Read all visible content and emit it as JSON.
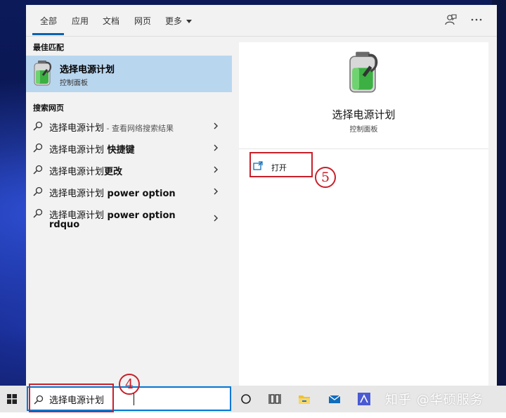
{
  "tabs": [
    {
      "label": "全部",
      "active": true
    },
    {
      "label": "应用"
    },
    {
      "label": "文档"
    },
    {
      "label": "网页"
    },
    {
      "label": "更多"
    }
  ],
  "sections": {
    "best_match": "最佳匹配",
    "web_search": "搜索网页"
  },
  "best_match": {
    "title": "选择电源计划",
    "subtitle": "控制面板"
  },
  "web_results": [
    {
      "query": "选择电源计划",
      "hint": " - 查看网络搜索结果"
    },
    {
      "query": "选择电源计划",
      "bold": " 快捷键"
    },
    {
      "query": "选择电源计划",
      "bold": "更改"
    },
    {
      "query": "选择电源计划",
      "bold": " power option"
    },
    {
      "query": "选择电源计划",
      "bold": " power option",
      "line2": "rdquo"
    }
  ],
  "detail": {
    "title": "选择电源计划",
    "subtitle": "控制面板",
    "open_label": "打开"
  },
  "annotations": {
    "step_open": "5",
    "step_search": "4"
  },
  "taskbar": {
    "search_value": "选择电源计划",
    "watermark": "知乎 @华硕服务"
  },
  "colors": {
    "accent": "#0063b1",
    "selected_bg": "#b9d6ef",
    "annotation_red": "#c8202a"
  },
  "icons": {
    "best_match": "battery-icon",
    "feedback": "feedback-icon",
    "more": "ellipsis-icon",
    "open": "open-window-icon"
  }
}
